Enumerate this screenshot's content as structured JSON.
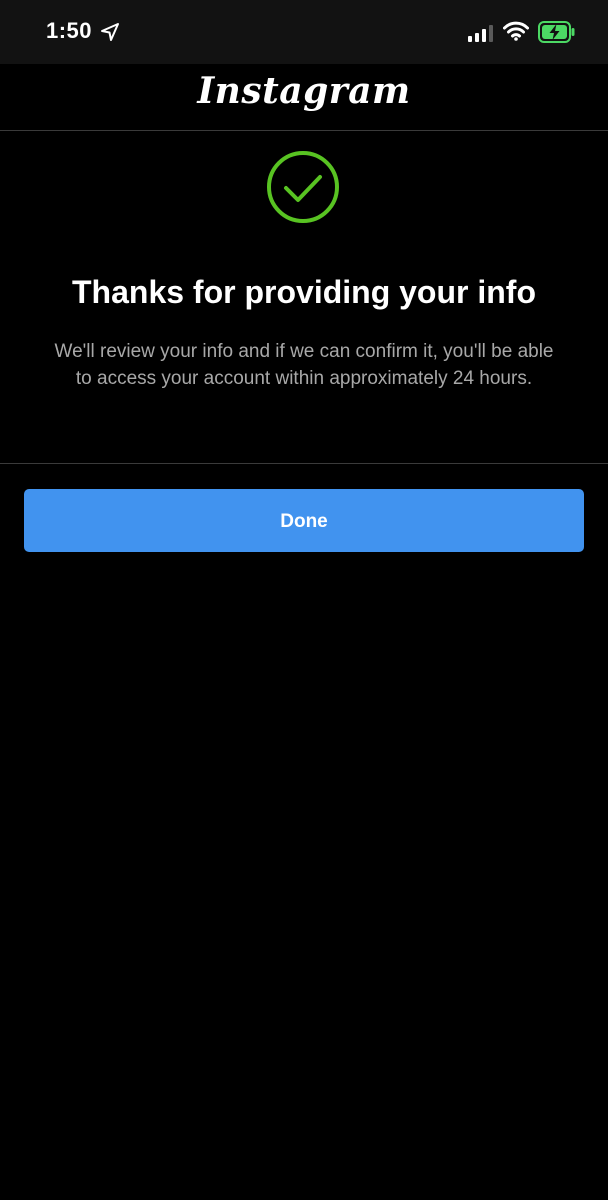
{
  "status_bar": {
    "time": "1:50",
    "icons": [
      "location-arrow-icon",
      "cellular-signal-icon",
      "wifi-icon",
      "battery-charging-icon"
    ],
    "battery_color": "#4cd964"
  },
  "header": {
    "logo_text": "Instagram"
  },
  "confirmation": {
    "icon": "check-circle-icon",
    "icon_color": "#58c322",
    "title": "Thanks for providing your info",
    "message": "We'll review your info and if we can confirm it, you'll be able to access your account within approximately 24 hours."
  },
  "actions": {
    "done_label": "Done",
    "button_color": "#4193ef"
  }
}
